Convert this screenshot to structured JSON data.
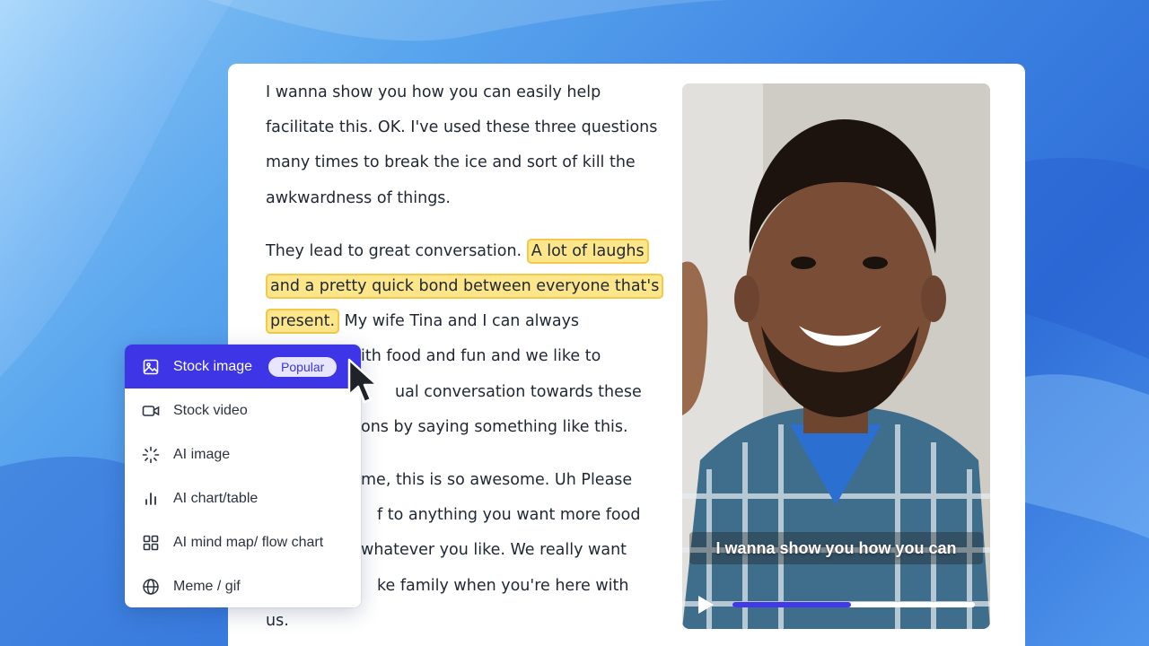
{
  "transcript": {
    "p1": "I wanna show you how you can easily help facilitate this. OK. I've used these three questions many times to break the ice and sort of kill the awkwardness of things.",
    "p2_before": "They lead to great conversation. ",
    "p2_highlight": "A lot of laughs and a pretty quick bond between everyone that's present.",
    "p2_after": " My wife Tina and I can always ... with food and fun and we like to ... casual conversation towards these ... questions by saying something like this.",
    "p2_visible_tail": "My wife Tina and I can always",
    "line_food": "ith food and fun and we like to",
    "line_ual": "ual conversation towards these",
    "line_ons": "ons by saying something like this.",
    "line_me": "me, this is so awesome. Uh Please",
    "line_f": "f to anything you want more food",
    "line_whatever": "whatever you like. We really want",
    "line_ke": "ke family when you're here with",
    "line_us": "us."
  },
  "video": {
    "caption": "I wanna show you how you can",
    "progress": 0.49,
    "accent": "#4338e8"
  },
  "menu": {
    "items": [
      {
        "label": "Stock image",
        "icon": "image-icon",
        "badge": "Popular"
      },
      {
        "label": "Stock video",
        "icon": "video-camera-icon"
      },
      {
        "label": "AI image",
        "icon": "sparkle-loader-icon"
      },
      {
        "label": "AI chart/table",
        "icon": "bar-chart-icon"
      },
      {
        "label": "AI mind map/ flow chart",
        "icon": "grid-icon"
      },
      {
        "label": "Meme / gif",
        "icon": "globe-icon"
      }
    ],
    "accent": "#3d35e6"
  }
}
